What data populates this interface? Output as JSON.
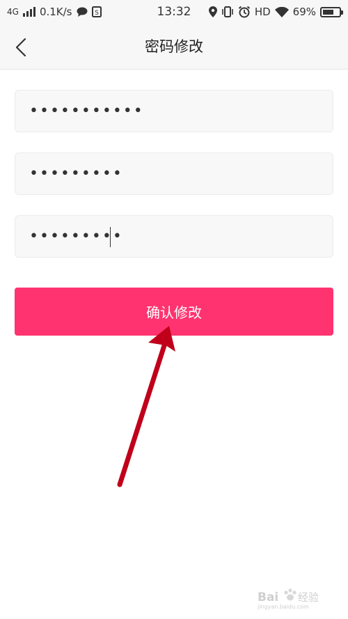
{
  "status_bar": {
    "network": "4G",
    "speed": "0.1K/s",
    "time": "13:32",
    "hd": "HD",
    "battery": "69%",
    "battery_level": 0.69
  },
  "nav": {
    "title": "密码修改"
  },
  "form": {
    "old_password": "•••••••••••",
    "new_password": "•••••••••",
    "confirm_password": "•••••••••"
  },
  "confirm_button": {
    "label": "确认修改"
  },
  "watermark": {
    "text": "Bai经验",
    "url": "jingyan.baidu.com"
  },
  "colors": {
    "accent": "#ff3370",
    "arrow": "#c0001a"
  }
}
